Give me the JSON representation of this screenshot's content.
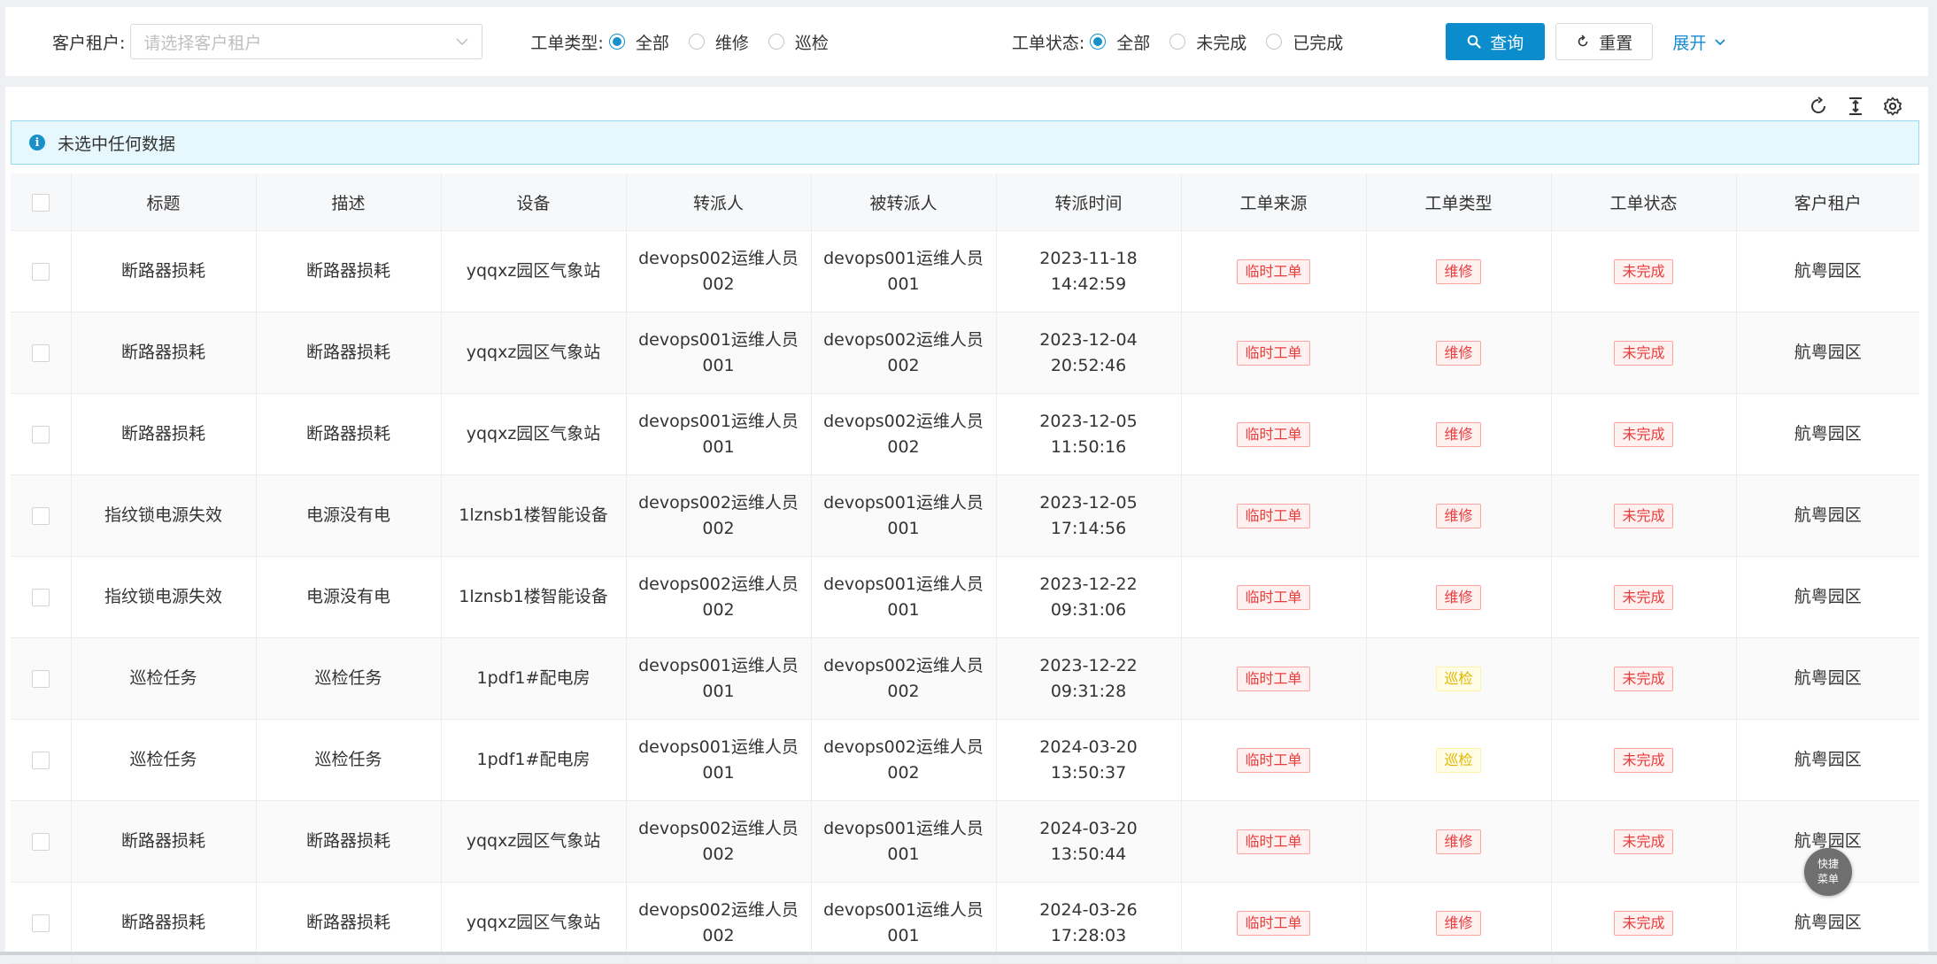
{
  "filters": {
    "tenant": {
      "label": "客户租户:",
      "placeholder": "请选择客户租户"
    },
    "type": {
      "label": "工单类型:",
      "options": [
        "全部",
        "维修",
        "巡检"
      ],
      "selected": "全部"
    },
    "status": {
      "label": "工单状态:",
      "options": [
        "全部",
        "未完成",
        "已完成"
      ],
      "selected": "全部"
    },
    "query_label": "查询",
    "reset_label": "重置",
    "expand_label": "展开"
  },
  "toolbar": {
    "icons": [
      "refresh-icon",
      "column-height-icon",
      "settings-icon"
    ]
  },
  "alert": {
    "text": "未选中任何数据"
  },
  "table": {
    "columns": [
      "标题",
      "描述",
      "设备",
      "转派人",
      "被转派人",
      "转派时间",
      "工单来源",
      "工单类型",
      "工单状态",
      "客户租户"
    ],
    "rows": [
      {
        "title": "断路器损耗",
        "desc": "断路器损耗",
        "device": "yqqxz园区气象站",
        "from": "devops002运维人员002",
        "to": "devops001运维人员001",
        "time": "2023-11-18 14:42:59",
        "source": "临时工单",
        "type": "维修",
        "status": "未完成",
        "tenant": "航粤园区"
      },
      {
        "title": "断路器损耗",
        "desc": "断路器损耗",
        "device": "yqqxz园区气象站",
        "from": "devops001运维人员001",
        "to": "devops002运维人员002",
        "time": "2023-12-04 20:52:46",
        "source": "临时工单",
        "type": "维修",
        "status": "未完成",
        "tenant": "航粤园区"
      },
      {
        "title": "断路器损耗",
        "desc": "断路器损耗",
        "device": "yqqxz园区气象站",
        "from": "devops001运维人员001",
        "to": "devops002运维人员002",
        "time": "2023-12-05 11:50:16",
        "source": "临时工单",
        "type": "维修",
        "status": "未完成",
        "tenant": "航粤园区"
      },
      {
        "title": "指纹锁电源失效",
        "desc": "电源没有电",
        "device": "1lznsb1楼智能设备",
        "from": "devops002运维人员002",
        "to": "devops001运维人员001",
        "time": "2023-12-05 17:14:56",
        "source": "临时工单",
        "type": "维修",
        "status": "未完成",
        "tenant": "航粤园区"
      },
      {
        "title": "指纹锁电源失效",
        "desc": "电源没有电",
        "device": "1lznsb1楼智能设备",
        "from": "devops002运维人员002",
        "to": "devops001运维人员001",
        "time": "2023-12-22 09:31:06",
        "source": "临时工单",
        "type": "维修",
        "status": "未完成",
        "tenant": "航粤园区"
      },
      {
        "title": "巡检任务",
        "desc": "巡检任务",
        "device": "1pdf1#配电房",
        "from": "devops001运维人员001",
        "to": "devops002运维人员002",
        "time": "2023-12-22 09:31:28",
        "source": "临时工单",
        "type": "巡检",
        "status": "未完成",
        "tenant": "航粤园区"
      },
      {
        "title": "巡检任务",
        "desc": "巡检任务",
        "device": "1pdf1#配电房",
        "from": "devops001运维人员001",
        "to": "devops002运维人员002",
        "time": "2024-03-20 13:50:37",
        "source": "临时工单",
        "type": "巡检",
        "status": "未完成",
        "tenant": "航粤园区"
      },
      {
        "title": "断路器损耗",
        "desc": "断路器损耗",
        "device": "yqqxz园区气象站",
        "from": "devops002运维人员002",
        "to": "devops001运维人员001",
        "time": "2024-03-20 13:50:44",
        "source": "临时工单",
        "type": "维修",
        "status": "未完成",
        "tenant": "航粤园区"
      },
      {
        "title": "断路器损耗",
        "desc": "断路器损耗",
        "device": "yqqxz园区气象站",
        "from": "devops002运维人员002",
        "to": "devops001运维人员001",
        "time": "2024-03-26 17:28:03",
        "source": "临时工单",
        "type": "维修",
        "status": "未完成",
        "tenant": "航粤园区"
      }
    ]
  },
  "fab": {
    "line1": "快捷",
    "line2": "菜单"
  },
  "colors": {
    "primary": "#0a8ccd",
    "link": "#1a8ad1",
    "tag_red": "#e83c3c",
    "tag_yellow": "#e0b500"
  }
}
